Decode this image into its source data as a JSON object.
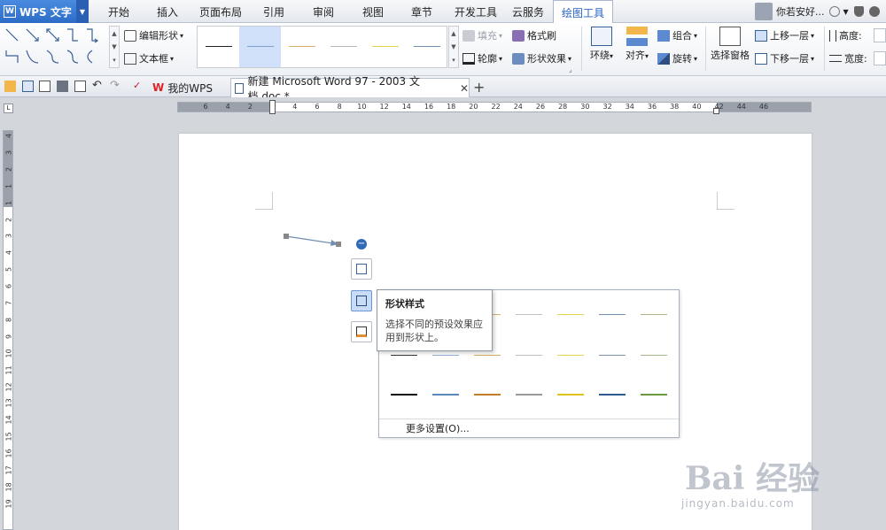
{
  "app": {
    "logo_label": "WPS 文字",
    "logo_glyph": "W"
  },
  "menu": {
    "tabs": [
      {
        "label": "开始"
      },
      {
        "label": "插入"
      },
      {
        "label": "页面布局"
      },
      {
        "label": "引用"
      },
      {
        "label": "审阅"
      },
      {
        "label": "视图"
      },
      {
        "label": "章节"
      },
      {
        "label": "开发工具"
      },
      {
        "label": "云服务"
      },
      {
        "label": "绘图工具"
      }
    ],
    "active_tab": "绘图工具"
  },
  "user": {
    "greeting": "你若安好..."
  },
  "ribbon": {
    "edit_shape": "编辑形状",
    "text_box": "文本框",
    "fill": "填充",
    "format_painter": "格式刷",
    "outline": "轮廓",
    "shape_effects": "形状效果",
    "wrap": "环绕",
    "align": "对齐",
    "group": "组合",
    "rotate": "旋转",
    "selection_pane": "选择窗格",
    "bring_forward": "上移一层",
    "send_backward": "下移一层",
    "height_label": "高度:",
    "width_label": "宽度:",
    "line_style_colors": [
      "#222222",
      "#7fa3d1",
      "#d9b466",
      "#b8b8b8",
      "#e6d24a",
      "#6f8fb1"
    ]
  },
  "quickbar": {
    "doc_tabs": [
      {
        "label": "我的WPS"
      },
      {
        "label": "新建 Microsoft Word 97 - 2003 文档.doc *"
      }
    ],
    "new_tab_symbol": "+"
  },
  "ruler": {
    "h_marks": [
      "6",
      "4",
      "2",
      "2",
      "4",
      "6",
      "8",
      "10",
      "12",
      "14",
      "16",
      "18",
      "20",
      "22",
      "24",
      "26",
      "28",
      "30",
      "32",
      "34",
      "36",
      "38",
      "40",
      "42",
      "44",
      "46"
    ],
    "v_marks": [
      "4",
      "3",
      "2",
      "1",
      "1",
      "2",
      "3",
      "4",
      "5",
      "6",
      "7",
      "8",
      "9",
      "10",
      "11",
      "12",
      "13",
      "14",
      "15",
      "16",
      "17",
      "18",
      "19"
    ]
  },
  "tooltip": {
    "title": "形状样式",
    "description": "选择不同的预设效果应用到形状上。"
  },
  "popup": {
    "more_settings": "更多设置(O)...",
    "row_colors": [
      [
        "#d9b466",
        "#bfbfbf",
        "#e6d24a",
        "#6f8fb1",
        "#a8b88a"
      ],
      [
        "#333333",
        "#8fb0d4",
        "#d6a864",
        "#bdbdbd",
        "#e7d352",
        "#7a93b0",
        "#a6b78a"
      ],
      [
        "#111111",
        "#5a89b9",
        "#c07d2a",
        "#9a9a9a",
        "#e0c21a",
        "#2f5a94",
        "#6b9a3d"
      ]
    ]
  },
  "watermark": {
    "brand": "Bai 经验",
    "url": "jingyan.baidu.com"
  },
  "colors": {
    "accent": "#2a64c4",
    "wps_blue": "#2c6cc7"
  }
}
